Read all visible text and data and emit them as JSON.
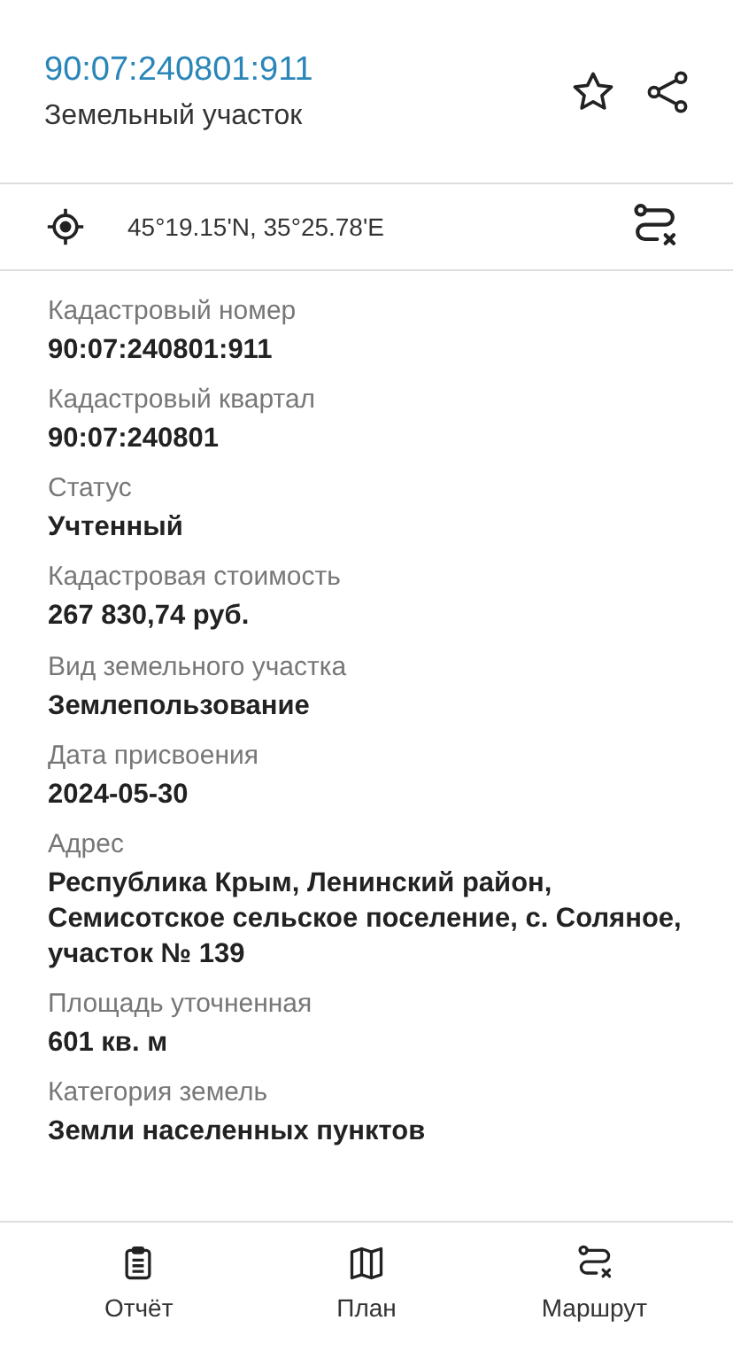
{
  "header": {
    "title": "90:07:240801:911",
    "subtitle": "Земельный участок",
    "favorite": false
  },
  "coordinates": {
    "text": "45°19.15'N, 35°25.78'E"
  },
  "fields": [
    {
      "label": "Кадастровый номер",
      "value": "90:07:240801:911"
    },
    {
      "label": "Кадастровый квартал",
      "value": "90:07:240801"
    },
    {
      "label": "Статус",
      "value": "Учтенный"
    },
    {
      "label": "Кадастровая стоимость",
      "value": "267 830,74 руб."
    },
    {
      "label": "Вид земельного участка",
      "value": "Землепользование"
    },
    {
      "label": "Дата присвоения",
      "value": "2024-05-30"
    },
    {
      "label": "Адрес",
      "value": " Республика Крым, Ленинский район, Семисотское сельское поселение, с. Соляное, участок № 139"
    },
    {
      "label": "Площадь уточненная",
      "value": "601 кв. м"
    },
    {
      "label": "Категория земель",
      "value": "Земли населенных пунктов"
    }
  ],
  "tab_bar": [
    {
      "kind": "report",
      "label": "Отчёт"
    },
    {
      "kind": "plan",
      "label": "План"
    },
    {
      "kind": "route",
      "label": "Маршрут"
    }
  ]
}
